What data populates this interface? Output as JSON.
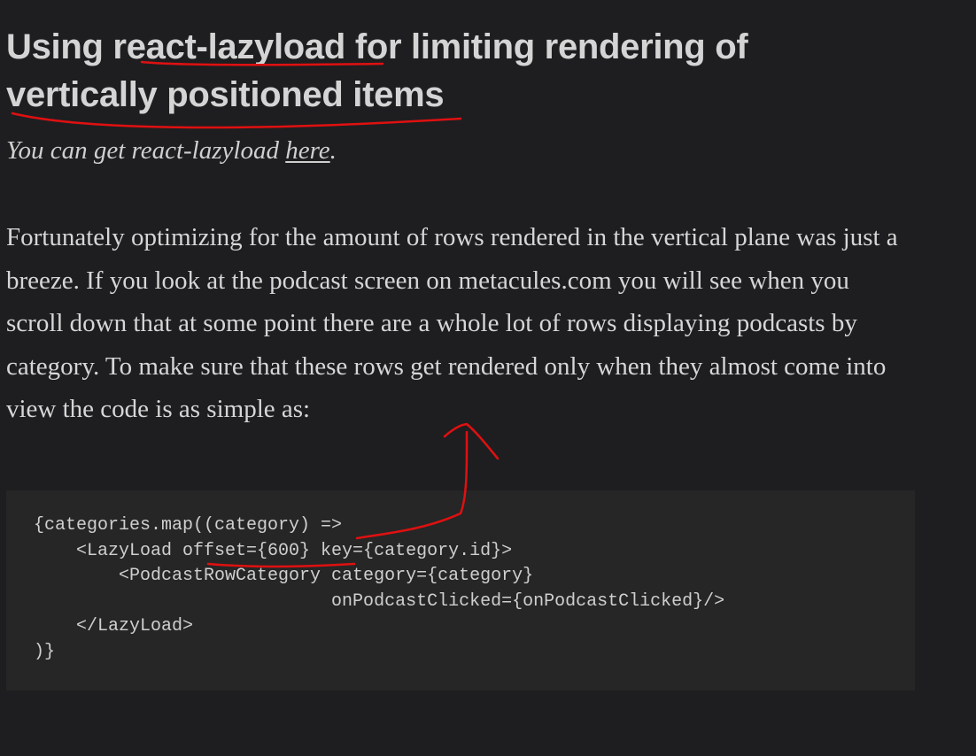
{
  "article": {
    "heading": "Using react-lazyload for limiting rendering of vertically positioned items",
    "subtitle_prefix": "You can get react-lazyload ",
    "subtitle_link": "here",
    "subtitle_suffix": ".",
    "paragraph": "Fortunately optimizing for the amount of rows rendered in the vertical plane was just a breeze. If you look at the podcast screen on metacules.com you will see when you scroll down that at some point there are a whole lot of rows displaying podcasts by category. To make sure that these rows get rendered only when they almost come into view the code is as simple as:",
    "code_lines": [
      "{categories.map((category) =>",
      "    <LazyLoad offset={600} key={category.id}>",
      "        <PodcastRowCategory category={category}",
      "                            onPodcastClicked={onPodcastClicked}/>",
      "    </LazyLoad>",
      ")}"
    ]
  },
  "annotations": {
    "ink_color": "#e01010",
    "marks": [
      "heading-underline",
      "offset-underline",
      "arrow-to-paragraph"
    ]
  }
}
